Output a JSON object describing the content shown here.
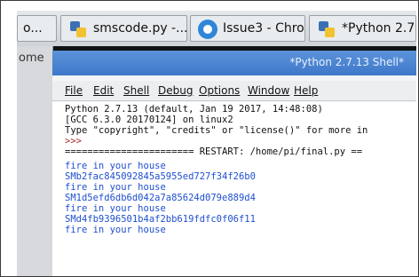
{
  "tabs": [
    {
      "label": "o..."
    },
    {
      "label": "smscode.py -..."
    },
    {
      "label": "Issue3 - Chro..."
    },
    {
      "label": "*Python 2.7..."
    }
  ],
  "left_fragment": "ome",
  "window": {
    "title": "*Python 2.7.13 Shell*"
  },
  "menus": [
    "File",
    "Edit",
    "Shell",
    "Debug",
    "Options",
    "Window",
    "Help"
  ],
  "console_lines": [
    {
      "text": "Python 2.7.13 (default, Jan 19 2017, 14:48:08)"
    },
    {
      "text": "[GCC 6.3.0 20170124] on linux2"
    },
    {
      "text": "Type \"copyright\", \"credits\" or \"license()\" for more in"
    },
    {
      "text": ">>>"
    },
    {
      "text": "======================= RESTART: /home/pi/final.py =="
    },
    {
      "text": "fire in your house"
    },
    {
      "text": "SMb2fac845092845a5955ed727f34f26b0"
    },
    {
      "text": "fire in your house"
    },
    {
      "text": "SM1d5efd6db6d042a7a85624d079e889d4"
    },
    {
      "text": "fire in your house"
    },
    {
      "text": "SMd4fb9396501b4af2bb619fdfc0f06f11"
    },
    {
      "text": "fire in your house"
    }
  ],
  "colors": {
    "prompt": "#a22b2b",
    "output": "#1f4fd1",
    "text": "#111111",
    "titlebar": "#3e78c9"
  }
}
